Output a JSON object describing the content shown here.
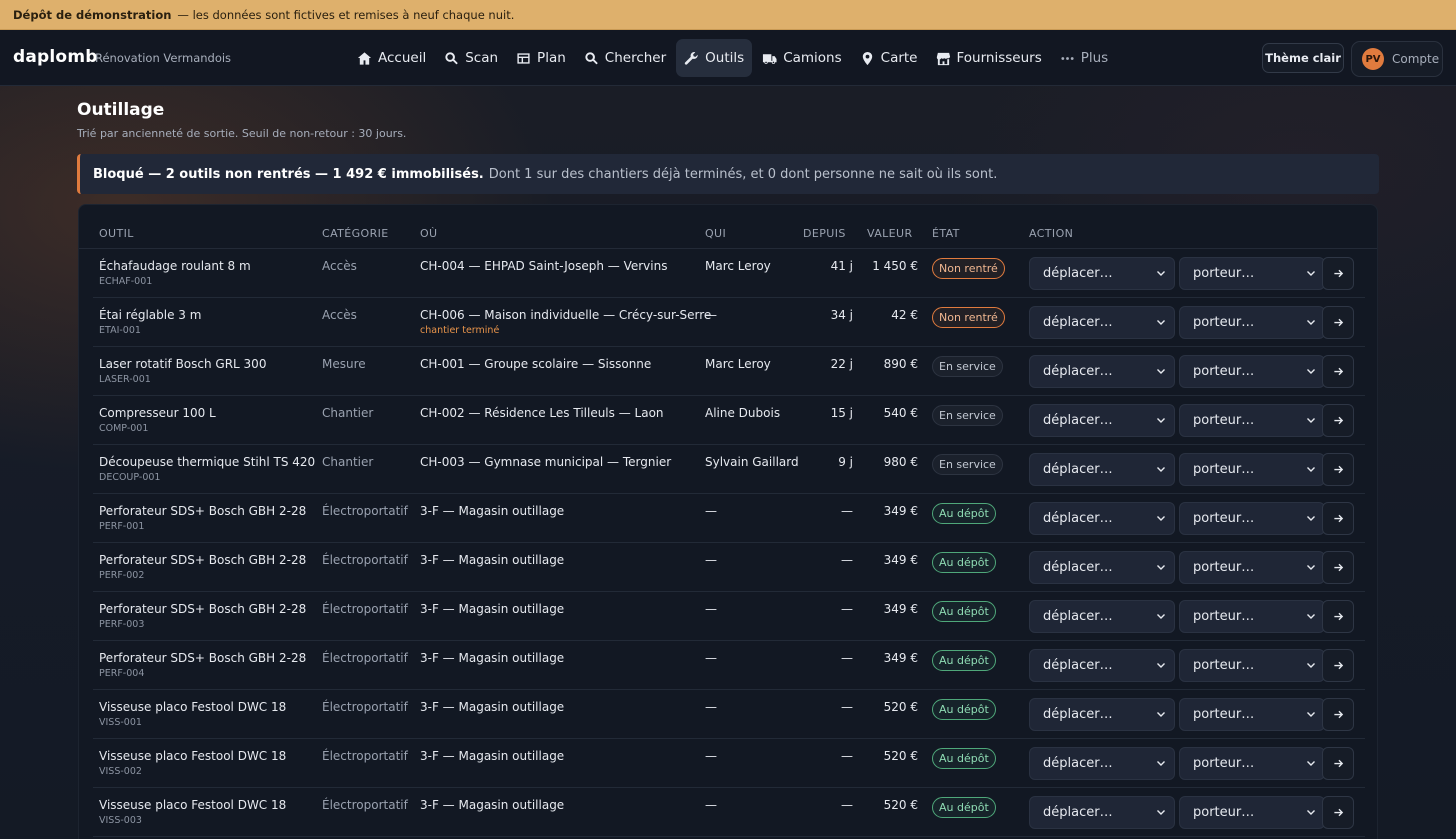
{
  "banner": {
    "title": "Dépôt de démonstration",
    "text": "— les données sont fictives et remises à neuf chaque nuit."
  },
  "header": {
    "brand": "daplomb",
    "company": "Rénovation Vermandois",
    "nav": [
      {
        "label": "Accueil",
        "icon": "home-icon",
        "active": false
      },
      {
        "label": "Scan",
        "icon": "search-icon",
        "active": false
      },
      {
        "label": "Plan",
        "icon": "calendar-icon",
        "active": false
      },
      {
        "label": "Chercher",
        "icon": "search-icon",
        "active": false
      },
      {
        "label": "Outils",
        "icon": "wrench-icon",
        "active": true
      },
      {
        "label": "Camions",
        "icon": "truck-icon",
        "active": false
      },
      {
        "label": "Carte",
        "icon": "map-pin-icon",
        "active": false
      },
      {
        "label": "Fournisseurs",
        "icon": "store-icon",
        "active": false
      },
      {
        "label": "Plus",
        "icon": "more-icon",
        "active": false
      }
    ],
    "theme_button": "Thème clair",
    "account_initials": "PV",
    "account_label": "Compte"
  },
  "page": {
    "title": "Outillage",
    "subtitle": "Trié par ancienneté de sortie. Seuil de non-retour : 30 jours."
  },
  "alert": {
    "strong": "Bloqué — 2 outils non rentrés — 1 492 € immobilisés.",
    "text": "Dont 1 sur des chantiers déjà terminés, et 0 dont personne ne sait où ils sont."
  },
  "table": {
    "columns": [
      "OUTIL",
      "CATÉGORIE",
      "OÙ",
      "QUI",
      "DEPUIS",
      "VALEUR",
      "ÉTAT",
      "ACTION"
    ],
    "move_placeholder": "déplacer…",
    "holder_placeholder": "porteur…",
    "rows": [
      {
        "name": "Échafaudage roulant 8 m",
        "code": "ECHAF-001",
        "category": "Accès",
        "where": "CH-004 — EHPAD Saint-Joseph — Vervins",
        "note": "",
        "who": "Marc Leroy",
        "since": "41 j",
        "value": "1 450 €",
        "state": "Non rentré",
        "tone": "red"
      },
      {
        "name": "Étai réglable 3 m",
        "code": "ETAI-001",
        "category": "Accès",
        "where": "CH-006 — Maison individuelle — Crécy-sur-Serre",
        "note": "chantier terminé",
        "who": "—",
        "since": "34 j",
        "value": "42 €",
        "state": "Non rentré",
        "tone": "red"
      },
      {
        "name": "Laser rotatif Bosch GRL 300",
        "code": "LASER-001",
        "category": "Mesure",
        "where": "CH-001 — Groupe scolaire — Sissonne",
        "note": "",
        "who": "Marc Leroy",
        "since": "22 j",
        "value": "890 €",
        "state": "En service",
        "tone": "grey"
      },
      {
        "name": "Compresseur 100 L",
        "code": "COMP-001",
        "category": "Chantier",
        "where": "CH-002 — Résidence Les Tilleuls — Laon",
        "note": "",
        "who": "Aline Dubois",
        "since": "15 j",
        "value": "540 €",
        "state": "En service",
        "tone": "grey"
      },
      {
        "name": "Découpeuse thermique Stihl TS 420",
        "code": "DECOUP-001",
        "category": "Chantier",
        "where": "CH-003 — Gymnase municipal — Tergnier",
        "note": "",
        "who": "Sylvain Gaillard",
        "since": "9 j",
        "value": "980 €",
        "state": "En service",
        "tone": "grey"
      },
      {
        "name": "Perforateur SDS+ Bosch GBH 2-28",
        "code": "PERF-001",
        "category": "Électroportatif",
        "where": "3-F — Magasin outillage",
        "note": "",
        "who": "—",
        "since": "—",
        "value": "349 €",
        "state": "Au dépôt",
        "tone": "green"
      },
      {
        "name": "Perforateur SDS+ Bosch GBH 2-28",
        "code": "PERF-002",
        "category": "Électroportatif",
        "where": "3-F — Magasin outillage",
        "note": "",
        "who": "—",
        "since": "—",
        "value": "349 €",
        "state": "Au dépôt",
        "tone": "green"
      },
      {
        "name": "Perforateur SDS+ Bosch GBH 2-28",
        "code": "PERF-003",
        "category": "Électroportatif",
        "where": "3-F — Magasin outillage",
        "note": "",
        "who": "—",
        "since": "—",
        "value": "349 €",
        "state": "Au dépôt",
        "tone": "green"
      },
      {
        "name": "Perforateur SDS+ Bosch GBH 2-28",
        "code": "PERF-004",
        "category": "Électroportatif",
        "where": "3-F — Magasin outillage",
        "note": "",
        "who": "—",
        "since": "—",
        "value": "349 €",
        "state": "Au dépôt",
        "tone": "green"
      },
      {
        "name": "Visseuse placo Festool DWC 18",
        "code": "VISS-001",
        "category": "Électroportatif",
        "where": "3-F — Magasin outillage",
        "note": "",
        "who": "—",
        "since": "—",
        "value": "520 €",
        "state": "Au dépôt",
        "tone": "green"
      },
      {
        "name": "Visseuse placo Festool DWC 18",
        "code": "VISS-002",
        "category": "Électroportatif",
        "where": "3-F — Magasin outillage",
        "note": "",
        "who": "—",
        "since": "—",
        "value": "520 €",
        "state": "Au dépôt",
        "tone": "green"
      },
      {
        "name": "Visseuse placo Festool DWC 18",
        "code": "VISS-003",
        "category": "Électroportatif",
        "where": "3-F — Magasin outillage",
        "note": "",
        "who": "—",
        "since": "—",
        "value": "520 €",
        "state": "Au dépôt",
        "tone": "green"
      }
    ]
  },
  "colors": {
    "accent": "#e07b3e",
    "banner": "#deb06c",
    "ok": "#4fa87a"
  }
}
